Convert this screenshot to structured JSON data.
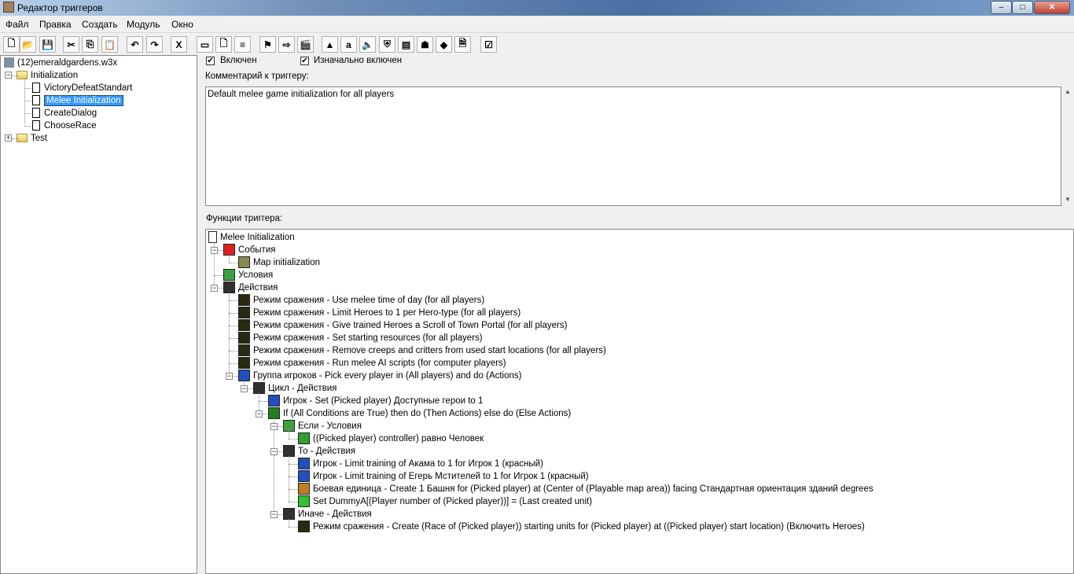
{
  "window": {
    "title": "Редактор триггеров",
    "minimize": "–",
    "maximize": "□",
    "close": "✕"
  },
  "menu": [
    "Файл",
    "Правка",
    "Создать",
    "Модуль",
    "Окно"
  ],
  "toolbar": [
    {
      "name": "new",
      "glyph": "🗋"
    },
    {
      "name": "open",
      "glyph": "📂"
    },
    {
      "name": "save",
      "glyph": "💾"
    },
    {
      "name": "cut",
      "glyph": "✂"
    },
    {
      "name": "copy",
      "glyph": "⎘"
    },
    {
      "name": "paste",
      "glyph": "📋"
    },
    {
      "name": "undo",
      "glyph": "↶"
    },
    {
      "name": "redo",
      "glyph": "↷"
    },
    {
      "name": "close-trigger",
      "glyph": "X"
    },
    {
      "name": "new-category",
      "glyph": "▭"
    },
    {
      "name": "new-trigger",
      "glyph": "🗋"
    },
    {
      "name": "new-comment",
      "glyph": "≡"
    },
    {
      "name": "new-event",
      "glyph": "⚑"
    },
    {
      "name": "new-condition",
      "glyph": "⇨"
    },
    {
      "name": "new-action",
      "glyph": "🎬"
    },
    {
      "name": "terrain-editor",
      "glyph": "▲"
    },
    {
      "name": "trigger-editor",
      "glyph": "a"
    },
    {
      "name": "sound-editor",
      "glyph": "🔈"
    },
    {
      "name": "object-editor",
      "glyph": "⛨"
    },
    {
      "name": "campaign-editor",
      "glyph": "▤"
    },
    {
      "name": "ai-editor",
      "glyph": "☗"
    },
    {
      "name": "import-manager",
      "glyph": "◆"
    },
    {
      "name": "object-manager",
      "glyph": "🗎"
    },
    {
      "name": "test-map",
      "glyph": "☑"
    }
  ],
  "tree": {
    "root": "(12)emeraldgardens.w3x",
    "nodes": [
      {
        "label": "Initialization",
        "type": "folder",
        "level": 1,
        "expander": "−"
      },
      {
        "label": "VictoryDefeatStandart",
        "type": "doc",
        "level": 2
      },
      {
        "label": "Melee Initialization",
        "type": "doc",
        "level": 2,
        "selected": true
      },
      {
        "label": "CreateDialog",
        "type": "doc",
        "level": 2
      },
      {
        "label": "ChooseRace",
        "type": "doc",
        "level": 2
      },
      {
        "label": "Test",
        "type": "folder",
        "level": 1,
        "expander": "+"
      }
    ]
  },
  "trigger": {
    "enabled_label": "Включен",
    "enabled": true,
    "initially_on_label": "Изначально включен",
    "initially_on": true,
    "comment_label": "Комментарий к триггеру:",
    "comment": "Default melee game initialization for all players",
    "functions_label": "Функции триггера:"
  },
  "functions": [
    {
      "text": "Melee Initialization",
      "level": 0,
      "icon": "doc"
    },
    {
      "text": "События",
      "level": 1,
      "icon": "flag",
      "exp": "−"
    },
    {
      "text": "Map initialization",
      "level": 2,
      "icon": "map"
    },
    {
      "text": "Условия",
      "level": 1,
      "icon": "cond"
    },
    {
      "text": "Действия",
      "level": 1,
      "icon": "clapper",
      "exp": "−"
    },
    {
      "text": "Режим сражения - Use melee time of day (for all players)",
      "level": 2,
      "icon": "melee"
    },
    {
      "text": "Режим сражения - Limit Heroes to 1 per Hero-type (for all players)",
      "level": 2,
      "icon": "melee"
    },
    {
      "text": "Режим сражения - Give trained Heroes a Scroll of Town Portal (for all players)",
      "level": 2,
      "icon": "melee"
    },
    {
      "text": "Режим сражения - Set starting resources (for all players)",
      "level": 2,
      "icon": "melee"
    },
    {
      "text": "Режим сражения - Remove creeps and critters from used start locations (for all players)",
      "level": 2,
      "icon": "melee"
    },
    {
      "text": "Режим сражения - Run melee AI scripts (for computer players)",
      "level": 2,
      "icon": "melee"
    },
    {
      "text": "Группа игроков - Pick every player in (All players) and do (Actions)",
      "level": 2,
      "icon": "player",
      "exp": "−"
    },
    {
      "text": "Цикл - Действия",
      "level": 3,
      "icon": "clapper",
      "exp": "−"
    },
    {
      "text": "Игрок - Set (Picked player) Доступные герои to 1",
      "level": 4,
      "icon": "player"
    },
    {
      "text": "If (All Conditions are True) then do (Then Actions) else do (Else Actions)",
      "level": 4,
      "icon": "if",
      "exp": "−"
    },
    {
      "text": "Если - Условия",
      "level": 5,
      "icon": "cond",
      "exp": "−"
    },
    {
      "text": "((Picked player) controller) равно Человек",
      "level": 6,
      "icon": "question"
    },
    {
      "text": "То - Действия",
      "level": 5,
      "icon": "clapper",
      "exp": "−"
    },
    {
      "text": "Игрок - Limit training of Акама to 1 for Игрок 1 (красный)",
      "level": 6,
      "icon": "player"
    },
    {
      "text": "Игрок - Limit training of Егерь Мстителей to 1 for Игрок 1 (красный)",
      "level": 6,
      "icon": "player"
    },
    {
      "text": "Боевая единица - Create 1 Башня for (Picked player) at (Center of (Playable map area)) facing Стандартная ориентация зданий degrees",
      "level": 6,
      "icon": "unit"
    },
    {
      "text": "Set DummyA[(Player number of (Picked player))] = (Last created unit)",
      "level": 6,
      "icon": "set"
    },
    {
      "text": "Иначе - Действия",
      "level": 5,
      "icon": "clapper",
      "exp": "−"
    },
    {
      "text": "Режим сражения - Create (Race of (Picked player)) starting units for (Picked player) at ((Picked player) start location) (Включить Heroes)",
      "level": 6,
      "icon": "melee"
    }
  ],
  "icon_colors": {
    "doc": "#ffffff",
    "flag": "#e02020",
    "map": "#8a8a50",
    "cond": "#40a040",
    "clapper": "#303030",
    "melee": "#2a2a10",
    "player": "#2050c0",
    "if": "#208020",
    "question": "#30a030",
    "unit": "#c08020",
    "set": "#30c030"
  }
}
